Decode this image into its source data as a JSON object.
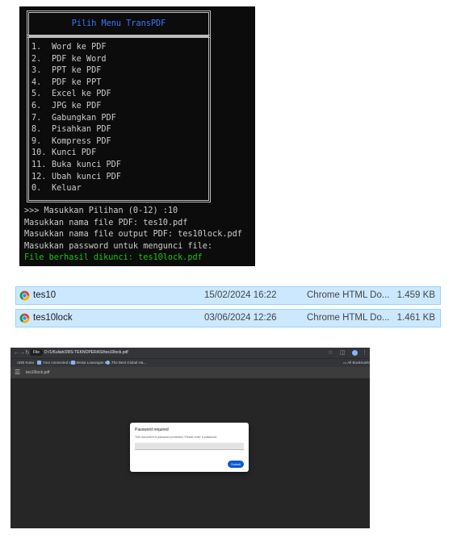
{
  "terminal": {
    "title": "Pilih Menu TransPDF",
    "menu": [
      {
        "num": "1.",
        "label": "Word ke PDF"
      },
      {
        "num": "2.",
        "label": "PDF ke Word"
      },
      {
        "num": "3.",
        "label": "PPT ke PDF"
      },
      {
        "num": "4.",
        "label": "PDF ke PPT"
      },
      {
        "num": "5.",
        "label": "Excel ke PDF"
      },
      {
        "num": "6.",
        "label": "JPG ke PDF"
      },
      {
        "num": "7.",
        "label": "Gabungkan PDF"
      },
      {
        "num": "8.",
        "label": "Pisahkan PDF"
      },
      {
        "num": "9.",
        "label": "Kompress PDF"
      },
      {
        "num": "10.",
        "label": "Kunci PDF"
      },
      {
        "num": "11.",
        "label": "Buka kunci PDF"
      },
      {
        "num": "12.",
        "label": "Ubah kunci PDF"
      },
      {
        "num": "0.",
        "label": "Keluar"
      }
    ],
    "lines": [
      ">>> Masukkan Pilihan (0-12) :10",
      "Masukkan nama file PDF: tes10.pdf",
      "Masukkan nama file output PDF: tes10lock.pdf",
      "Masukkan password untuk mengunci file:"
    ],
    "success_line": "File berhasil dikunci: tes10lock.pdf",
    "colors": {
      "background": "#0c0c0c",
      "text": "#cccccc",
      "title": "#3b78ff",
      "success": "#16c60c"
    }
  },
  "files": [
    {
      "name": "tes10",
      "date": "15/02/2024 16:22",
      "type": "Chrome HTML Do...",
      "size": "1.459 KB",
      "icon": "chrome-icon"
    },
    {
      "name": "tes10lock",
      "date": "03/06/2024 12:26",
      "type": "Chrome HTML Do...",
      "size": "1.461 KB",
      "icon": "chrome-icon"
    }
  ],
  "browser": {
    "file_chip": "File",
    "url": "D:/1/Kuliah/2RS-TEKNOPERASI/tes10lock.pdf",
    "bookmarks": [
      "ADB Kutai",
      "Your connected serv...",
      "Resia Lowongan Ke...",
      "The Best Global Ha..."
    ],
    "bookmarks_folder": "All Bookmarks",
    "pdf_filename": "tes10lock.pdf",
    "dialog": {
      "title": "Password required",
      "description": "This document is password protected. Please enter a password.",
      "input_value": "",
      "submit_label": "Submit"
    }
  }
}
